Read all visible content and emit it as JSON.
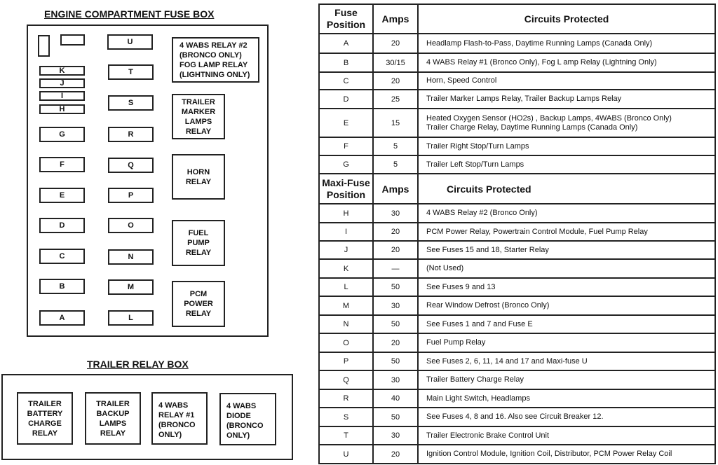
{
  "engine_box": {
    "title": "ENGINE COMPARTMENT FUSE BOX",
    "fuses_left": [
      "K",
      "J",
      "I",
      "H",
      "G",
      "F",
      "E",
      "D",
      "C",
      "B",
      "A"
    ],
    "fuses_middle": [
      "U",
      "T",
      "S",
      "R",
      "Q",
      "P",
      "O",
      "N",
      "M",
      "L"
    ],
    "relays": [
      "4 WABS RELAY  #2\n(BRONCO ONLY)\nFOG LAMP RELAY\n(LIGHTNING ONLY)",
      "TRAILER\nMARKER\nLAMPS\nRELAY",
      "HORN\nRELAY",
      "FUEL\nPUMP\nRELAY",
      "PCM\nPOWER\nRELAY"
    ]
  },
  "trailer_box": {
    "title": "TRAILER RELAY BOX",
    "relays": [
      "TRAILER\nBATTERY\nCHARGE\nRELAY",
      "TRAILER\nBACKUP\nLAMPS\nRELAY",
      "4 WABS\nRELAY  #1\n(BRONCO\nONLY)",
      "4 WABS\nDIODE\n(BRONCO\nONLY)"
    ]
  },
  "table": {
    "header": {
      "position": "Fuse\nPosition",
      "amps": "Amps",
      "circuits": "Circuits Protected"
    },
    "fuse_rows": [
      {
        "position": "A",
        "amps": "20",
        "circuits": "Headlamp Flash-to-Pass, Daytime Running Lamps (Canada Only)"
      },
      {
        "position": "B",
        "amps": "30/15",
        "circuits": "4 WABS Relay #1 (Bronco Only), Fog L amp Relay (Lightning Only)"
      },
      {
        "position": "C",
        "amps": "20",
        "circuits": "Horn, Speed Control"
      },
      {
        "position": "D",
        "amps": "25",
        "circuits": "Trailer Marker Lamps Relay, Trailer Backup Lamps Relay"
      },
      {
        "position": "E",
        "amps": "15",
        "circuits": "Heated Oxygen Sensor (HO2s) , Backup Lamps, 4WABS (Bronco Only)\nTrailer Charge Relay, Daytime Running Lamps (Canada Only)"
      },
      {
        "position": "F",
        "amps": "5",
        "circuits": "Trailer Right Stop/Turn Lamps"
      },
      {
        "position": "G",
        "amps": "5",
        "circuits": "Trailer Left Stop/Turn Lamps"
      }
    ],
    "maxi_header": {
      "position": "Maxi-Fuse\nPosition",
      "amps": "Amps",
      "circuits": "Circuits Protected"
    },
    "maxi_rows": [
      {
        "position": "H",
        "amps": "30",
        "circuits": "4 WABS Relay #2 (Bronco Only)"
      },
      {
        "position": "I",
        "amps": "20",
        "circuits": "PCM Power Relay, Powertrain Control Module, Fuel Pump Relay"
      },
      {
        "position": "J",
        "amps": "20",
        "circuits": "See Fuses 15 and 18, Starter Relay"
      },
      {
        "position": "K",
        "amps": "—",
        "circuits": "(Not Used)"
      },
      {
        "position": "L",
        "amps": "50",
        "circuits": "See Fuses 9 and 13"
      },
      {
        "position": "M",
        "amps": "30",
        "circuits": "Rear Window Defrost (Bronco Only)"
      },
      {
        "position": "N",
        "amps": "50",
        "circuits": "See Fuses 1 and 7 and Fuse E"
      },
      {
        "position": "O",
        "amps": "20",
        "circuits": "Fuel Pump Relay"
      },
      {
        "position": "P",
        "amps": "50",
        "circuits": "See Fuses 2, 6, 11, 14 and 17 and Maxi-fuse U"
      },
      {
        "position": "Q",
        "amps": "30",
        "circuits": "Trailer Battery Charge Relay"
      },
      {
        "position": "R",
        "amps": "40",
        "circuits": "Main Light Switch, Headlamps"
      },
      {
        "position": "S",
        "amps": "50",
        "circuits": "See Fuses 4, 8 and 16. Also see Circuit Breaker 12."
      },
      {
        "position": "T",
        "amps": "30",
        "circuits": "Trailer Electronic Brake Control Unit"
      },
      {
        "position": "U",
        "amps": "20",
        "circuits": "Ignition Control Module, Ignition Coil, Distributor, PCM Power Relay Coil"
      }
    ]
  }
}
